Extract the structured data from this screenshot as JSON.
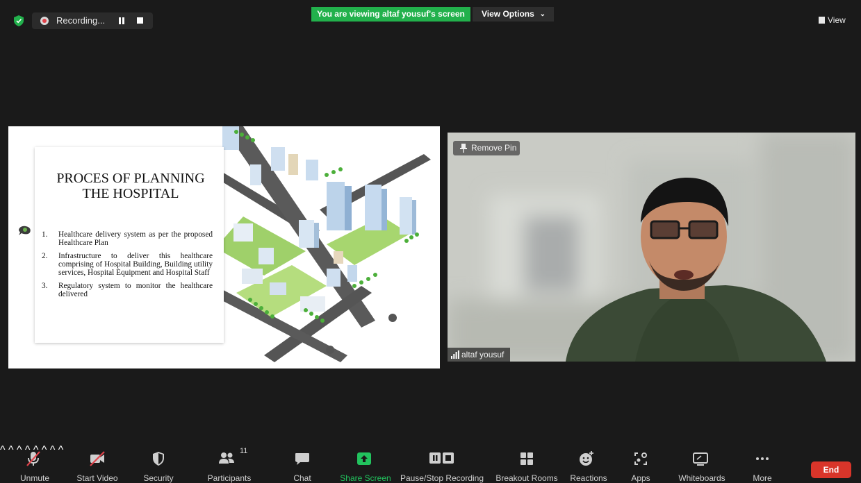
{
  "top_bar": {
    "recording_label": "Recording...",
    "viewing_banner": "You are viewing altaf yousuf's screen",
    "view_options_label": "View Options",
    "view_label": "View"
  },
  "slide": {
    "title": "PROCES OF PLANNING THE HOSPITAL",
    "items": [
      {
        "num": "1.",
        "text": "Healthcare delivery system as per the proposed Healthcare Plan"
      },
      {
        "num": "2.",
        "text": "Infrastructure to deliver this healthcare comprising of Hospital Building, Building utility services, Hospital Equipment and Hospital Staff"
      },
      {
        "num": "3.",
        "text": "Regulatory system to monitor the healthcare delivered"
      }
    ]
  },
  "video": {
    "remove_pin_label": "Remove Pin",
    "participant_name": "altaf yousuf"
  },
  "toolbar": {
    "unmute": "Unmute",
    "start_video": "Start Video",
    "security": "Security",
    "participants": "Participants",
    "participants_count": "11",
    "chat": "Chat",
    "share_screen": "Share Screen",
    "pause_stop_recording": "Pause/Stop Recording",
    "breakout_rooms": "Breakout Rooms",
    "reactions": "Reactions",
    "apps": "Apps",
    "whiteboards": "Whiteboards",
    "more": "More",
    "end": "End"
  },
  "colors": {
    "background": "#1a1a1a",
    "banner_green": "#22b14c",
    "share_green": "#22c35e",
    "end_red": "#d9352a"
  }
}
